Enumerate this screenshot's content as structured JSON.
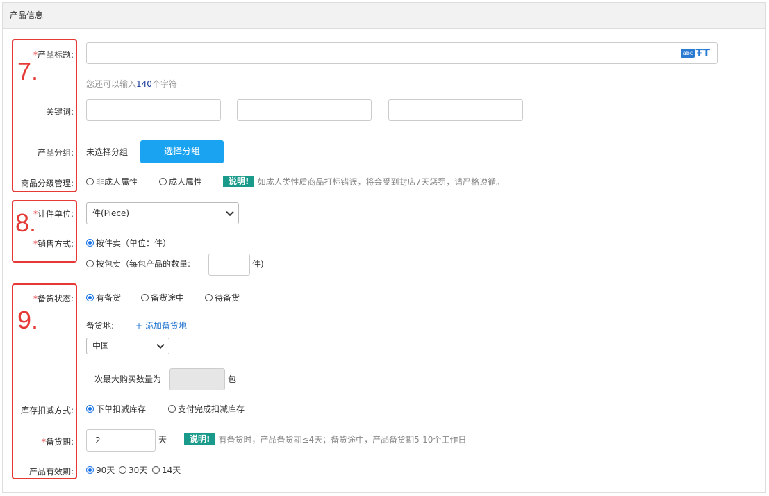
{
  "section_title": "产品信息",
  "colors": {
    "accent": "#1aa3f0",
    "badge": "#1a9a8a",
    "annotation": "#e53935",
    "required": "#e4393c"
  },
  "annotations": [
    "7.",
    "8.",
    "9."
  ],
  "fields": {
    "title": {
      "label": "产品标题:",
      "required": "*",
      "value": "",
      "placeholder": "",
      "icons": [
        "abc-spellcheck-icon",
        "text-format-icon"
      ],
      "hint_prefix": "您还可以输入",
      "hint_count": "140",
      "hint_suffix": "个字符"
    },
    "keywords": {
      "label": "关键词:",
      "values": [
        "",
        "",
        ""
      ]
    },
    "group": {
      "label": "产品分组:",
      "status": "未选择分组",
      "button": "选择分组"
    },
    "rating": {
      "label": "商品分级管理:",
      "options": [
        "非成人属性",
        "成人属性"
      ],
      "selected": "",
      "note_badge": "说明!",
      "note_text": "如成人类性质商品打标错误，将会受到封店7天惩罚，请严格遵循。"
    },
    "unit": {
      "label": "计件单位:",
      "required": "*",
      "value": "件(Piece)"
    },
    "sale": {
      "label": "销售方式:",
      "required": "*",
      "option1": "按件卖（单位：件）",
      "option2": "按包卖（每包产品的数量:",
      "option2_suffix": "件)",
      "pack_qty": "",
      "selected": "按件卖"
    },
    "stock_status": {
      "label": "备货状态:",
      "required": "*",
      "options": [
        "有备货",
        "备货途中",
        "待备货"
      ],
      "selected": "有备货"
    },
    "stock_location": {
      "label": "备货地:",
      "add_link": "+ 添加备货地",
      "country": "中国"
    },
    "max_buy": {
      "prefix": "一次最大购买数量为",
      "value": "",
      "suffix": "包"
    },
    "inventory": {
      "label": "库存扣减方式:",
      "options": [
        "下单扣减库存",
        "支付完成扣减库存"
      ],
      "selected": "下单扣减库存"
    },
    "lead_time": {
      "label": "备货期:",
      "required": "*",
      "value": "2",
      "unit": "天",
      "note_badge": "说明!",
      "note_text": "有备货时，产品备货期≤4天；备货途中，产品备货期5-10个工作日"
    },
    "validity": {
      "label": "产品有效期:",
      "options": [
        "90天",
        "30天",
        "14天"
      ],
      "selected": "90天"
    }
  }
}
